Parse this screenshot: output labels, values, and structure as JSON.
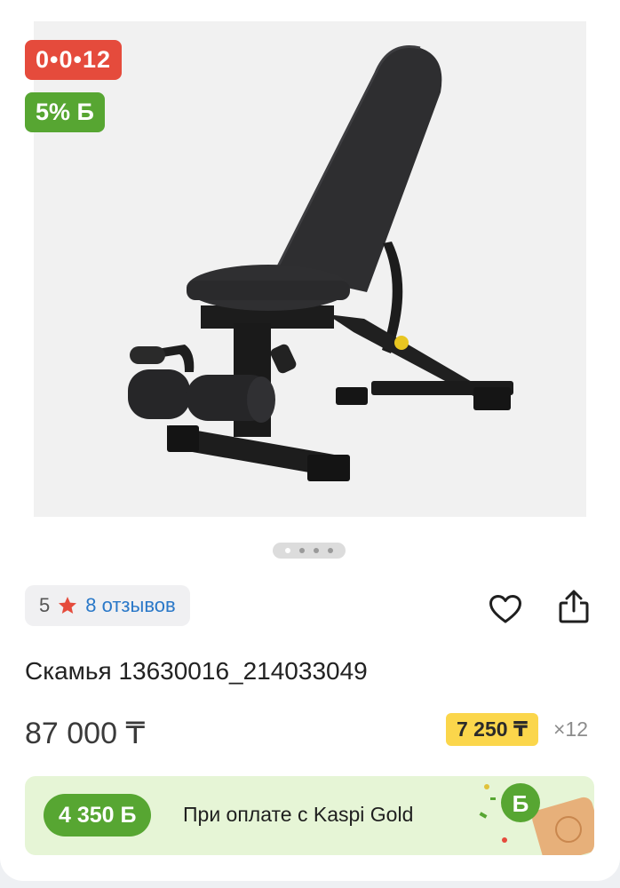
{
  "product": {
    "installment_badge": "0•0•12",
    "bonus_badge": "5% Б",
    "gallery": {
      "slides": 4,
      "active_index": 0
    },
    "rating": {
      "value": "5",
      "reviews_label": "8 отзывов"
    },
    "title": "Скамья 13630016_214033049",
    "price": "87 000 ₸",
    "monthly_payment": "7 250 ₸",
    "months": "×12"
  },
  "kaspi_gold": {
    "bonus_amount": "4 350 Б",
    "label": "При оплате с Kaspi Gold"
  },
  "icons": {
    "rating": "star-icon",
    "favorite": "heart-icon",
    "share": "share-icon"
  },
  "colors": {
    "installment_red": "#e54b3c",
    "bonus_green": "#57a632",
    "link_blue": "#2a78c8",
    "monthly_yellow": "#fbd64b",
    "gold_banner_bg": "#e6f5d6"
  }
}
